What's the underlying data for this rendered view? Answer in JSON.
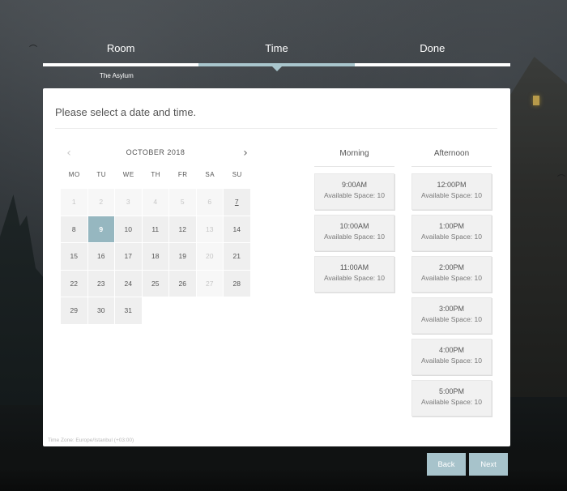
{
  "steps": {
    "items": [
      {
        "label": "Room"
      },
      {
        "label": "Time"
      },
      {
        "label": "Done"
      }
    ],
    "active_index": 1,
    "room_selected": "The Asylum"
  },
  "panel": {
    "title": "Please select a date and time.",
    "timezone": "Time Zone: Europe/Istanbul (+03:00)"
  },
  "calendar": {
    "month_label": "OCTOBER 2018",
    "weekdays": [
      "MO",
      "TU",
      "WE",
      "TH",
      "FR",
      "SA",
      "SU"
    ],
    "days": [
      {
        "label": "1",
        "state": "muted"
      },
      {
        "label": "2",
        "state": "muted"
      },
      {
        "label": "3",
        "state": "muted"
      },
      {
        "label": "4",
        "state": "muted"
      },
      {
        "label": "5",
        "state": "muted"
      },
      {
        "label": "6",
        "state": "muted"
      },
      {
        "label": "7",
        "state": "today"
      },
      {
        "label": "8",
        "state": "normal"
      },
      {
        "label": "9",
        "state": "selected"
      },
      {
        "label": "10",
        "state": "normal"
      },
      {
        "label": "11",
        "state": "normal"
      },
      {
        "label": "12",
        "state": "normal"
      },
      {
        "label": "13",
        "state": "muted"
      },
      {
        "label": "14",
        "state": "normal"
      },
      {
        "label": "15",
        "state": "normal"
      },
      {
        "label": "16",
        "state": "normal"
      },
      {
        "label": "17",
        "state": "normal"
      },
      {
        "label": "18",
        "state": "normal"
      },
      {
        "label": "19",
        "state": "normal"
      },
      {
        "label": "20",
        "state": "muted"
      },
      {
        "label": "21",
        "state": "normal"
      },
      {
        "label": "22",
        "state": "normal"
      },
      {
        "label": "23",
        "state": "normal"
      },
      {
        "label": "24",
        "state": "normal"
      },
      {
        "label": "25",
        "state": "normal"
      },
      {
        "label": "26",
        "state": "normal"
      },
      {
        "label": "27",
        "state": "muted"
      },
      {
        "label": "28",
        "state": "normal"
      },
      {
        "label": "29",
        "state": "normal"
      },
      {
        "label": "30",
        "state": "normal"
      },
      {
        "label": "31",
        "state": "normal"
      }
    ]
  },
  "slots": {
    "morning": {
      "heading": "Morning",
      "items": [
        {
          "time": "9:00AM",
          "availability": "Available Space: 10"
        },
        {
          "time": "10:00AM",
          "availability": "Available Space: 10"
        },
        {
          "time": "11:00AM",
          "availability": "Available Space: 10"
        }
      ]
    },
    "afternoon": {
      "heading": "Afternoon",
      "items": [
        {
          "time": "12:00PM",
          "availability": "Available Space: 10"
        },
        {
          "time": "1:00PM",
          "availability": "Available Space: 10"
        },
        {
          "time": "2:00PM",
          "availability": "Available Space: 10"
        },
        {
          "time": "3:00PM",
          "availability": "Available Space: 10"
        },
        {
          "time": "4:00PM",
          "availability": "Available Space: 10"
        },
        {
          "time": "5:00PM",
          "availability": "Available Space: 10"
        }
      ]
    }
  },
  "buttons": {
    "back_label": "Back",
    "next_label": "Next"
  },
  "colors": {
    "accent": "#a7c3cb",
    "selected_day": "#96b7c0"
  },
  "icons": {
    "prev": "chevron-left-icon",
    "next": "chevron-right-icon"
  }
}
